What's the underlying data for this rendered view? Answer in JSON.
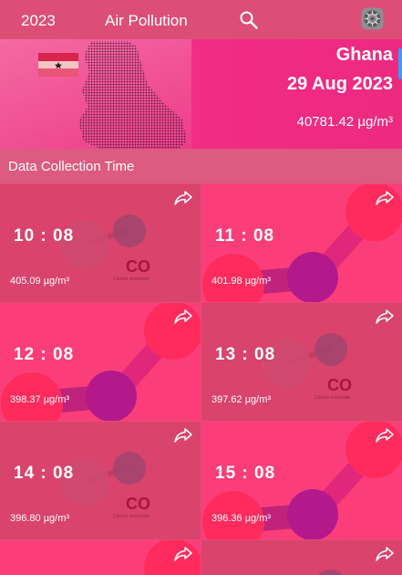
{
  "topbar": {
    "year": "2023",
    "title": "Air Pollution",
    "search_icon": "search-icon",
    "settings_icon": "settings-icon"
  },
  "hero": {
    "country": "Ghana",
    "date": "29 Aug 2023",
    "total": "40781.42 µg/m³"
  },
  "section": {
    "label": "Data Collection Time"
  },
  "readings": [
    {
      "time": "10 : 08",
      "value": "405.09 µg/m³",
      "style": "co"
    },
    {
      "time": "11 : 08",
      "value": "401.98 µg/m³",
      "style": "molecule"
    },
    {
      "time": "12 : 08",
      "value": "398.37 µg/m³",
      "style": "molecule"
    },
    {
      "time": "13 : 08",
      "value": "397.62 µg/m³",
      "style": "co"
    },
    {
      "time": "14 : 08",
      "value": "396.80 µg/m³",
      "style": "co"
    },
    {
      "time": "15 : 08",
      "value": "396.36 µg/m³",
      "style": "molecule"
    }
  ],
  "colors": {
    "topbar": "#dc4e76",
    "hero": "#f12b84",
    "tile_co": "#d9436c",
    "tile_molecule": "#fb3e7a"
  }
}
